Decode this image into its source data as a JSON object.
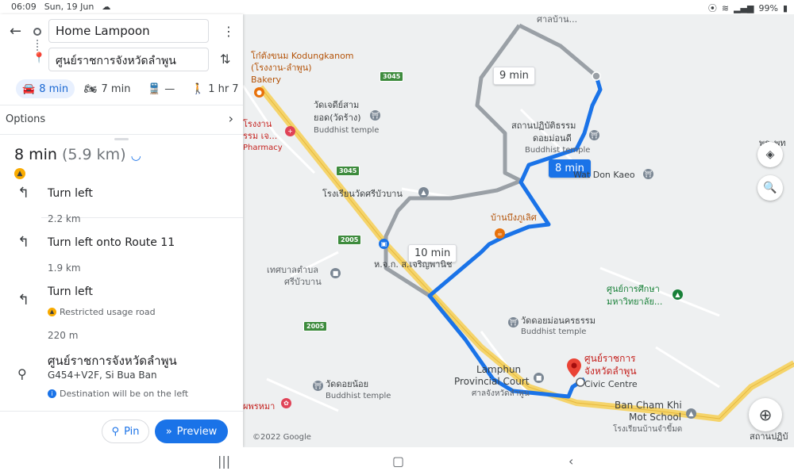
{
  "status": {
    "time": "06:09",
    "date": "Sun, 19 Jun",
    "battery": "99%"
  },
  "directions": {
    "origin": "Home Lampoon",
    "destination": "ศูนย์ราชการจังหวัดลำพูน",
    "modes": [
      {
        "icon": "car-icon",
        "label": "8 min"
      },
      {
        "icon": "motorbike-icon",
        "label": "7 min"
      },
      {
        "icon": "transit-icon",
        "label": "—"
      },
      {
        "icon": "walk-icon",
        "label": "1 hr 7"
      }
    ],
    "options_label": "Options",
    "summary_time": "8 min",
    "summary_dist": "(5.9 km)"
  },
  "steps": [
    {
      "text": "Turn left",
      "distance": "2.2 km"
    },
    {
      "text": "Turn left onto Route 11",
      "distance": "1.9 km"
    },
    {
      "text": "Turn left",
      "note": "Restricted usage road",
      "distance": "220 m"
    },
    {
      "text": "ศูนย์ราชการจังหวัดลำพูน",
      "sub": "G454+V2F, Si Bua Ban",
      "note": "Destination will be on the left"
    }
  ],
  "buttons": {
    "pin": "Pin",
    "preview": "Preview"
  },
  "map": {
    "route_labels": {
      "alt1": "9 min",
      "selected": "8 min",
      "alt2": "10 min"
    },
    "places": {
      "kodungkanom": "โก๋ตังขนม Kodungkanom",
      "kodungkanom2": "(โรงงาน-ลำพูน)",
      "bakery": "Bakery",
      "pharmacy_th1": "โรงงาน",
      "pharmacy_th2": "รรม เจ...",
      "pharmacy": "Pharmacy",
      "temple1a": "วัดเจดีย์สาม",
      "temple1b": "ยอด(วัดร้าง)",
      "temple1c": "Buddhist temple",
      "practice1": "สถานปฏิบัติธรรม",
      "practice2": "ดอยม่อนดี",
      "practice3": "Buddhist temple",
      "school": "โรงเรียนวัดศรีบัวบาน",
      "cafe": "บ้านบึงภูเลิศ",
      "watdonkaeo": "Wat Don Kaeo",
      "shop": "ห.จ.ก. ส.เจริญพานิช",
      "municipality1": "เทศบาลตำบล",
      "municipality2": "ศรีบัวบาน",
      "edu1": "ศูนย์การศึกษา",
      "edu2": "มหาวิทยาลัย...",
      "watdoimon1": "วัดดอยม่อนครธรรม",
      "watdoimon2": "Buddhist temple",
      "court1": "Lamphun",
      "court2": "Provincial Court",
      "court3": "ศาลจังหวัดลำพูน",
      "dest1": "ศูนย์ราชการ",
      "dest2": "จังหวัดลำพูน",
      "civic": "Civic Centre",
      "watdoinoi1": "วัดดอยน้อย",
      "watdoinoi2": "Buddhist temple",
      "school2a": "Ban Cham Khi",
      "school2b": "Mot School",
      "school2c": "โรงเรียนบ้านจำขี้มด",
      "right1": "พระพุท",
      "right2": "สถานปฏิบั",
      "left_bottom": "ผพรหมา",
      "top_cut": "ศาลบ้าน..."
    },
    "shields": [
      "3045",
      "3045",
      "2005",
      "2005"
    ],
    "copyright": "©2022 Google"
  },
  "colors": {
    "route": "#1a73e8",
    "alt_route": "#9aa0a6",
    "highway": "#f5d46b",
    "accent": "#1a73e8"
  }
}
